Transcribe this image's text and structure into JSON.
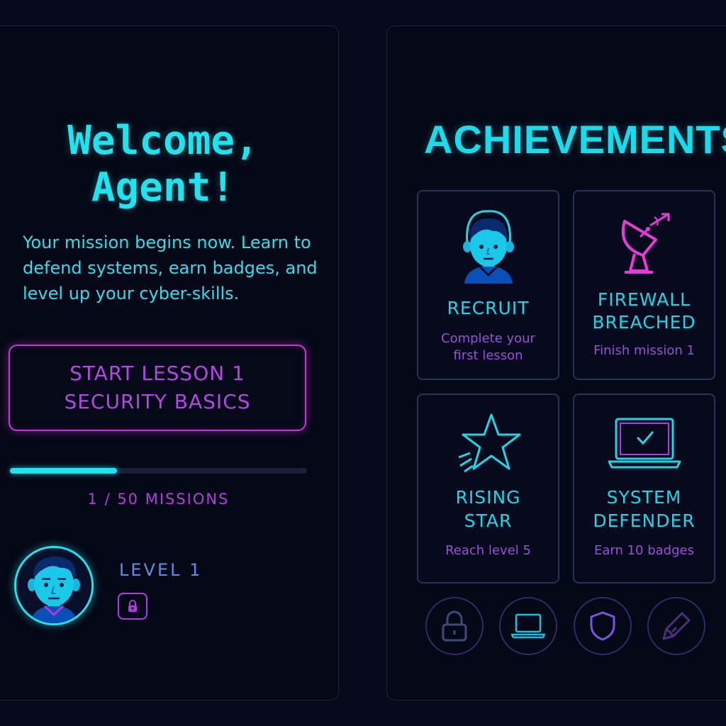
{
  "welcome": {
    "line1": "Welcome,",
    "line2": "Agent!",
    "mission_text": "Your mission begins now. Learn to defend systems, earn badges, and level up your cyber-skills."
  },
  "start_button": {
    "line1": "START LESSON 1",
    "line2": "SECURITY BASICS"
  },
  "progress": {
    "current": 1,
    "total": 50,
    "label": "1 / 50 MISSIONS"
  },
  "profile": {
    "level_label": "LEVEL 1",
    "lock_icon": "lock-icon"
  },
  "achievements": {
    "title": "ACHIEVEMENTS",
    "items": [
      {
        "icon": "recruit-avatar-icon",
        "title_line1": "RECRUIT",
        "title_line2": "",
        "description_line1": "Complete your",
        "description_line2": "first lesson"
      },
      {
        "icon": "satellite-dish-icon",
        "title_line1": "FIREWALL",
        "title_line2": "BREACHED",
        "description_line1": "Finish mission 1",
        "description_line2": ""
      },
      {
        "icon": "shooting-star-icon",
        "title_line1": "RISING",
        "title_line2": "STAR",
        "description_line1": "Reach level 5",
        "description_line2": ""
      },
      {
        "icon": "laptop-check-icon",
        "title_line1": "SYSTEM",
        "title_line2": "DEFENDER",
        "description_line1": "Earn 10 badges",
        "description_line2": ""
      }
    ],
    "locked_badges": [
      "padlock-icon",
      "laptop-icon",
      "shield-icon",
      "pencil-icon"
    ]
  },
  "colors": {
    "cyan": "#1ee4ef",
    "magenta": "#c43ad6",
    "purple": "#9a4fd8",
    "background": "#050816"
  }
}
